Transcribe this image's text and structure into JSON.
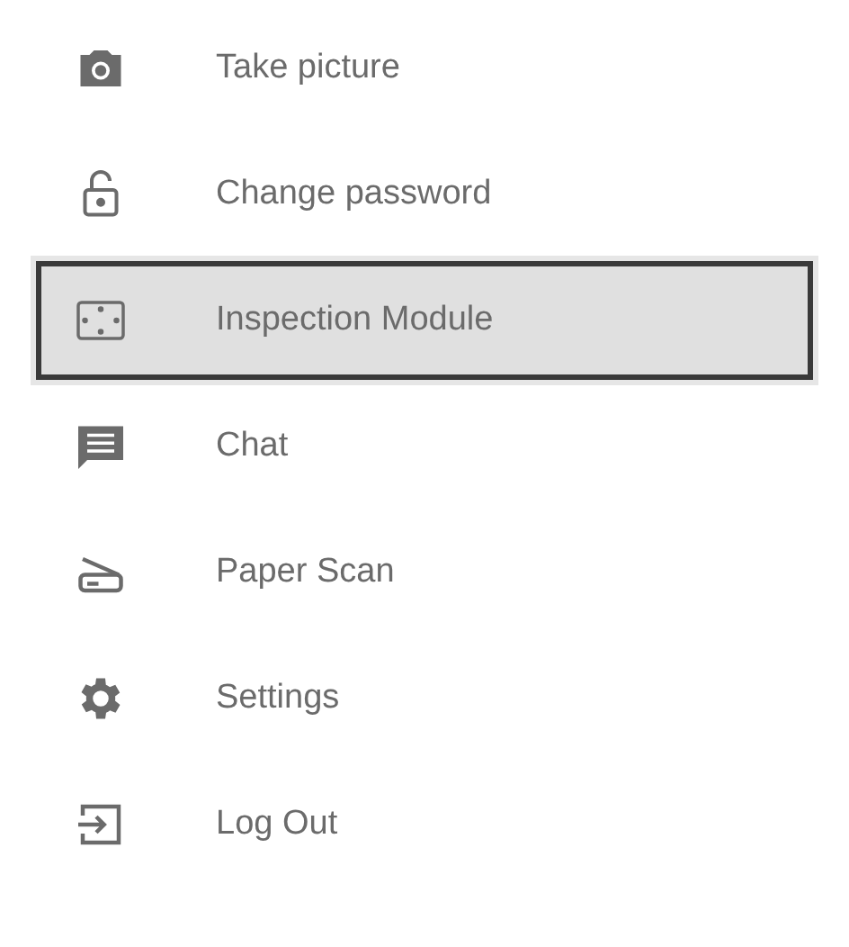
{
  "menu": {
    "items": [
      {
        "kind": "camera",
        "label": "Take picture",
        "selected": false
      },
      {
        "kind": "lock",
        "label": "Change password",
        "selected": false
      },
      {
        "kind": "frame",
        "label": "Inspection Module",
        "selected": true
      },
      {
        "kind": "chat",
        "label": "Chat",
        "selected": false
      },
      {
        "kind": "scanner",
        "label": "Paper Scan",
        "selected": false
      },
      {
        "kind": "gear",
        "label": "Settings",
        "selected": false
      },
      {
        "kind": "logout",
        "label": "Log Out",
        "selected": false
      }
    ]
  }
}
